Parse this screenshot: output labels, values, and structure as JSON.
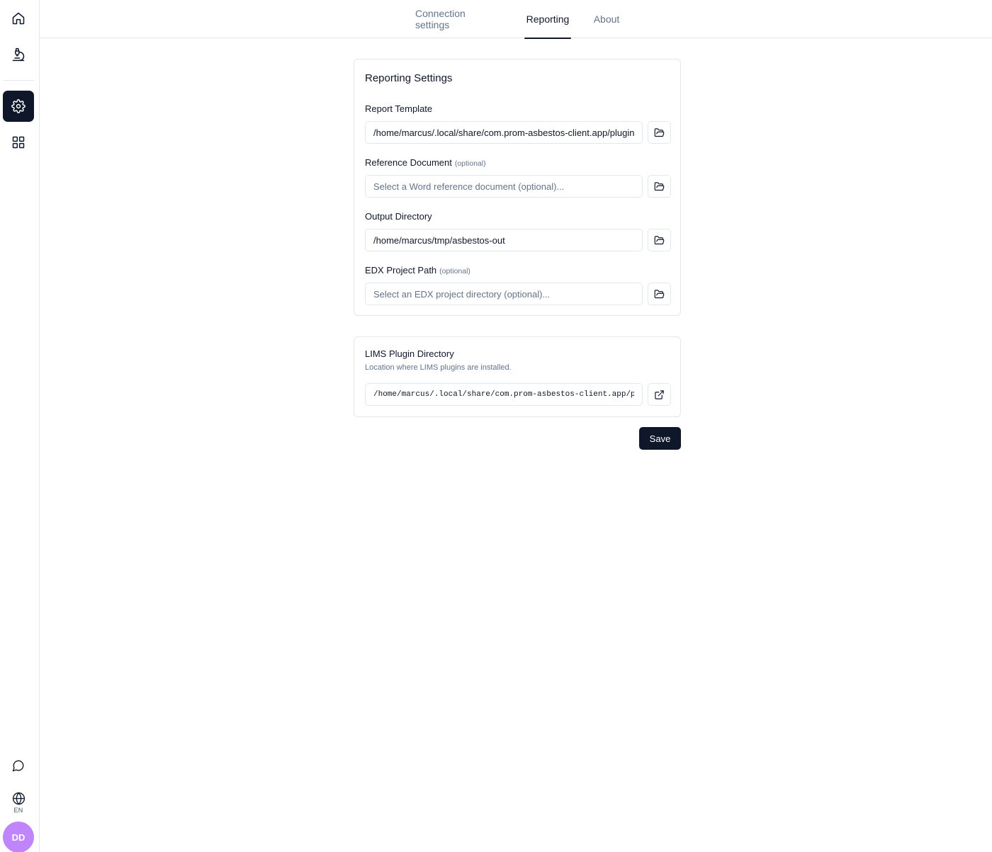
{
  "sidebar": {
    "items": [
      {
        "id": "home",
        "icon": "home-icon",
        "active": false
      },
      {
        "id": "microscope",
        "icon": "microscope-icon",
        "active": false
      },
      {
        "id": "settings",
        "icon": "gear-icon",
        "active": true
      },
      {
        "id": "apps",
        "icon": "grid-icon",
        "active": false
      }
    ],
    "chat_icon": "message-circle-icon",
    "language_code": "EN",
    "avatar_initials": "DD",
    "avatar_color": "#c084fc",
    "active_color": "#0f172a"
  },
  "tabs": [
    {
      "label": "Connection settings",
      "active": false
    },
    {
      "label": "Reporting",
      "active": true
    },
    {
      "label": "About",
      "active": false
    }
  ],
  "reporting": {
    "title": "Reporting Settings",
    "fields": [
      {
        "label": "Report Template",
        "optional_tag": "",
        "value": "/home/marcus/.local/share/com.prom-asbestos-client.app/plugins/",
        "placeholder": "",
        "button_icon": "folder-open-icon"
      },
      {
        "label": "Reference Document",
        "optional_tag": "(optional)",
        "value": "",
        "placeholder": "Select a Word reference document (optional)...",
        "button_icon": "folder-open-icon"
      },
      {
        "label": "Output Directory",
        "optional_tag": "",
        "value": "/home/marcus/tmp/asbestos-out",
        "placeholder": "",
        "button_icon": "folder-open-icon"
      },
      {
        "label": "EDX Project Path",
        "optional_tag": "(optional)",
        "value": "",
        "placeholder": "Select an EDX project directory (optional)...",
        "button_icon": "folder-open-icon"
      }
    ]
  },
  "lims": {
    "title": "LIMS Plugin Directory",
    "description": "Location where LIMS plugins are installed.",
    "value": "/home/marcus/.local/share/com.prom-asbestos-client.app/plugins",
    "button_icon": "external-link-icon"
  },
  "save_label": "Save"
}
